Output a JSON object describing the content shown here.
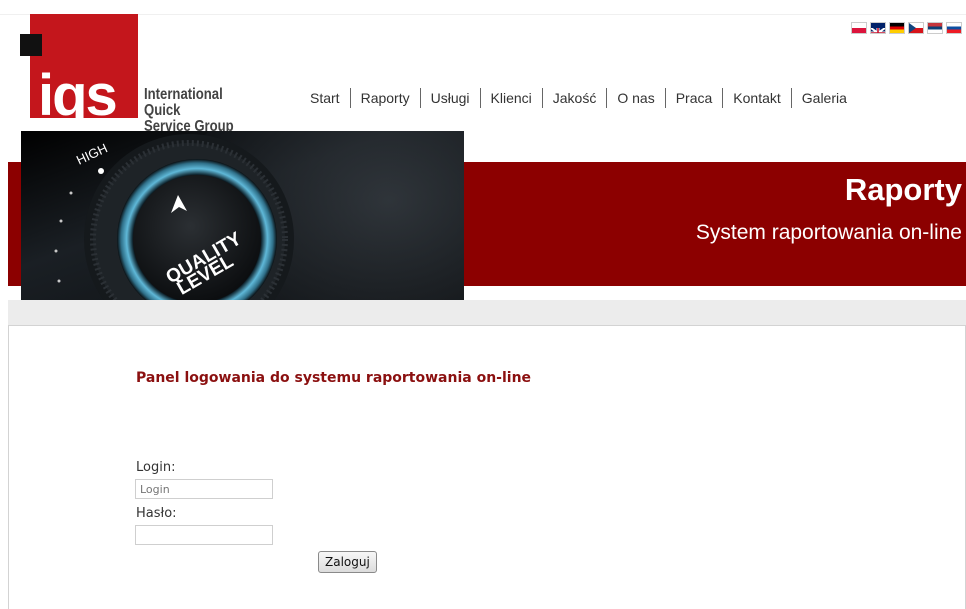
{
  "logo": {
    "mark": "iqs",
    "name_line1": "International Quick",
    "name_line2": "Service Group"
  },
  "flags": [
    {
      "name": "pl-flag"
    },
    {
      "name": "uk-flag"
    },
    {
      "name": "de-flag"
    },
    {
      "name": "cz-flag"
    },
    {
      "name": "rs-flag"
    },
    {
      "name": "sk-flag"
    }
  ],
  "nav": [
    "Start",
    "Raporty",
    "Usługi",
    "Klienci",
    "Jakość",
    "O nas",
    "Praca",
    "Kontakt",
    "Galeria"
  ],
  "hero": {
    "knob_high": "HIGH",
    "knob_line1": "QUALITY",
    "knob_line2": "LEVEL"
  },
  "banner": {
    "title": "Raporty",
    "subtitle": "System raportowania on-line"
  },
  "login_panel": {
    "title": "Panel logowania do systemu raportowania on-line",
    "login_label": "Login:",
    "login_placeholder": "Login",
    "password_label": "Hasło:",
    "submit_label": "Zaloguj"
  },
  "colors": {
    "brand_red": "#c4161c",
    "banner_red": "#8c0000",
    "title_red": "#8b1010"
  }
}
